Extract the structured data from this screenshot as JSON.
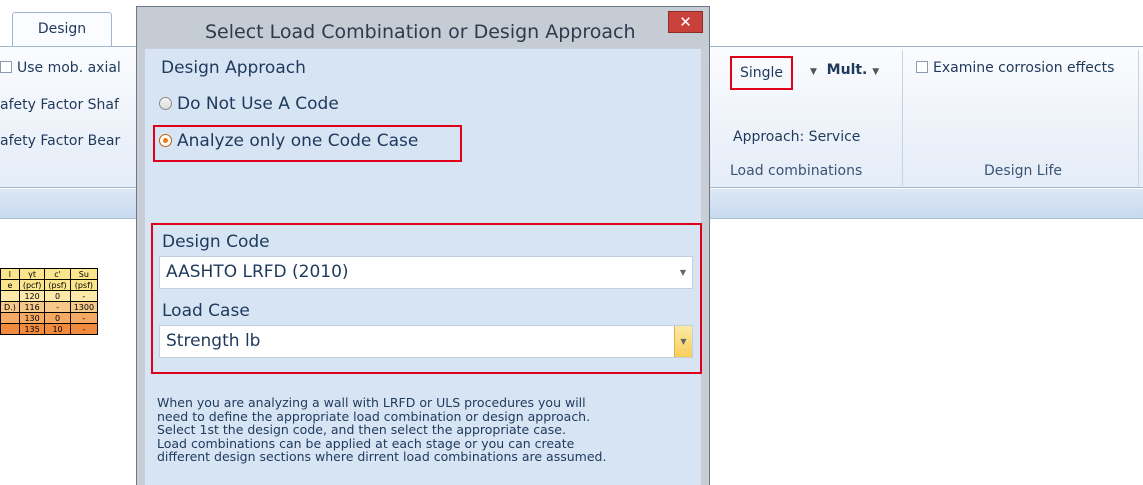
{
  "ribbon": {
    "tab_design": "Design",
    "use_mob_axial": "Use mob. axial",
    "safety_factor_shaft": "afety Factor Shaf",
    "safety_factor_bear": "afety Factor Bear",
    "single_label": "Single",
    "mult_label": "Mult.",
    "examine_corrosion": "Examine corrosion effects",
    "approach_text": "Approach:  Service",
    "group_load_combinations": "Load combinations",
    "group_design_life": "Design Life"
  },
  "soil_table": {
    "header1": [
      "l",
      "γt",
      "c'",
      "Su"
    ],
    "header2": [
      "e",
      "(pcf)",
      "(psf)",
      "(psf)"
    ],
    "rows": [
      {
        "name": "",
        "g": "120",
        "c": "0",
        "su": "-",
        "color": "#fce8a8"
      },
      {
        "name": "D.)",
        "g": "116",
        "c": "-",
        "su": "1300",
        "color": "#f6c98a"
      },
      {
        "name": "",
        "g": "130",
        "c": "0",
        "su": "-",
        "color": "#f5a962"
      },
      {
        "name": "",
        "g": "135",
        "c": "10",
        "su": "-",
        "color": "#f08a3c"
      }
    ]
  },
  "dialog": {
    "title": "Select Load Combination or Design Approach",
    "close_glyph": "✕",
    "design_approach_heading": "Design Approach",
    "options": [
      {
        "label": "Do Not Use A Code",
        "selected": false
      },
      {
        "label": "Analyze only one Code Case",
        "selected": true
      }
    ],
    "design_code_label": "Design Code",
    "design_code_value": "AASHTO LRFD (2010)",
    "load_case_label": "Load Case",
    "load_case_value": "Strength lb",
    "help_lines": [
      "When you are analyzing a wall with LRFD or ULS procedures you will",
      "need to define the appropriate load combination or design approach.",
      "Select 1st the design code, and then select the appropriate case.",
      "Load combinations can be applied at each stage or you can create",
      "different design sections where dirrent load combinations are assumed."
    ]
  },
  "colors": {
    "highlight_red": "#e0001a",
    "radio_selected": "#ef7c10",
    "dialog_body": "#d7e4f4"
  },
  "icons": {
    "dropdown": "chevron-down-icon",
    "close": "close-icon"
  }
}
